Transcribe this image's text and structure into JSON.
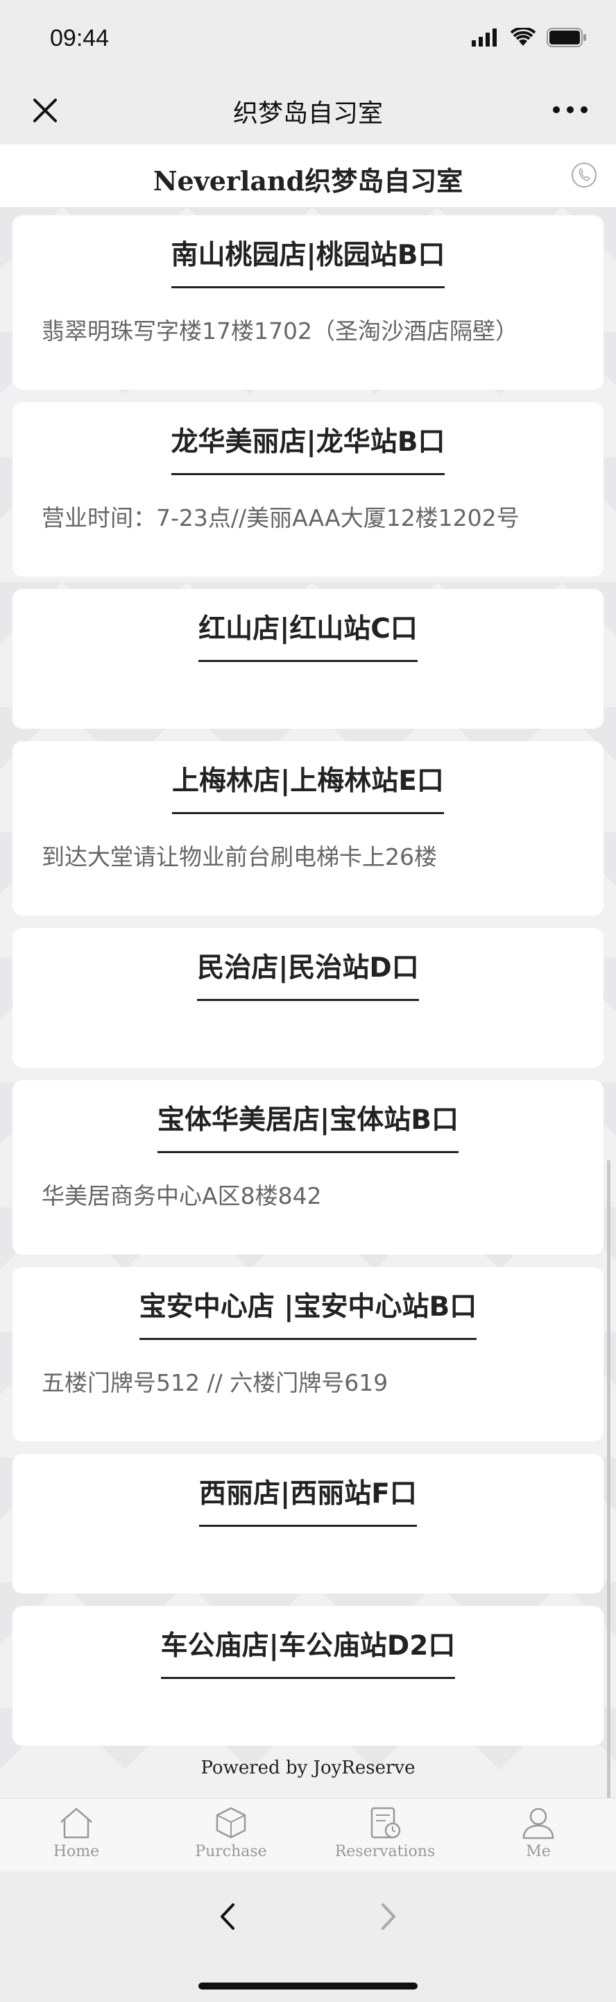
{
  "status_bar": {
    "time": "09:44"
  },
  "navbar": {
    "title": "织梦岛自习室"
  },
  "page": {
    "title": "Neverland织梦岛自习室"
  },
  "stores": [
    {
      "name": "南山桃园店|桃园站B口",
      "desc": "翡翠明珠写字楼17楼1702（圣淘沙酒店隔壁）"
    },
    {
      "name": "龙华美丽店|龙华站B口",
      "desc": "营业时间：7-23点//美丽AAA大厦12楼1202号"
    },
    {
      "name": "红山店|红山站C口",
      "desc": ""
    },
    {
      "name": "上梅林店|上梅林站E口",
      "desc": "到达大堂请让物业前台刷电梯卡上26楼"
    },
    {
      "name": "民治店|民治站D口",
      "desc": ""
    },
    {
      "name": "宝体华美居店|宝体站B口",
      "desc": "华美居商务中心A区8楼842"
    },
    {
      "name": "宝安中心店 |宝安中心站B口",
      "desc": "五楼门牌号512 // 六楼门牌号619"
    },
    {
      "name": "西丽店|西丽站F口",
      "desc": ""
    },
    {
      "name": "车公庙店|车公庙站D2口",
      "desc": ""
    }
  ],
  "footer": {
    "powered": "Powered by JoyReserve"
  },
  "tabs": [
    {
      "label": "Home",
      "icon": "home-icon"
    },
    {
      "label": "Purchase",
      "icon": "box-icon"
    },
    {
      "label": "Reservations",
      "icon": "calendar-clock-icon"
    },
    {
      "label": "Me",
      "icon": "user-icon"
    }
  ]
}
